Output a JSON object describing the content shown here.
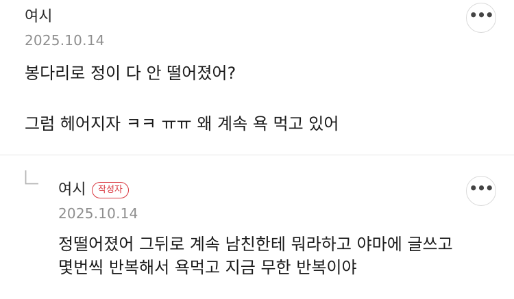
{
  "comments": [
    {
      "author": "여시",
      "date": "2025.10.14",
      "lines": [
        "봉다리로 정이 다 안 떨어졌어?",
        "그럼 헤어지자 ㅋㅋ ㅠㅠ 왜 계속 욕 먹고 있어"
      ],
      "more_label": "•••"
    },
    {
      "author": "여시",
      "badge": "작성자",
      "date": "2025.10.14",
      "lines": [
        "정떨어졌어 그뒤로 계속 남친한테 뭐라하고 야마에 글쓰고",
        "몇번씩 반복해서 욕먹고 지금 무한 반복이야"
      ],
      "more_label": "•••"
    }
  ],
  "icons": {
    "more": "more-horizontal-icon",
    "reply": "reply-arrow-icon"
  },
  "colors": {
    "badge": "#d9363e",
    "date": "#8e8e8e",
    "divider": "#e4e4e4"
  }
}
